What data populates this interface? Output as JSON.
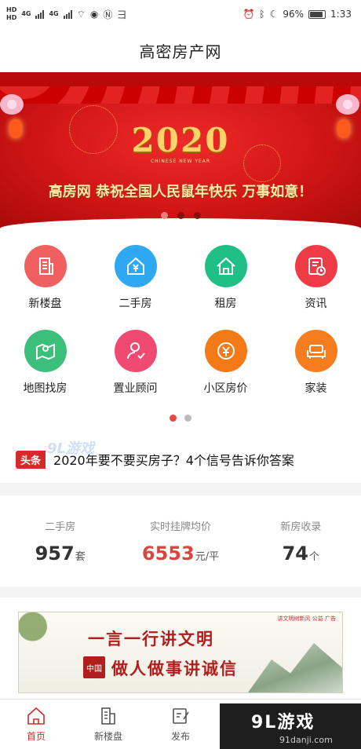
{
  "status_bar": {
    "hd1": "HD",
    "hd2": "HD",
    "net1": "4G",
    "net2": "4G",
    "battery": "96%",
    "time": "1:33"
  },
  "header": {
    "title": "高密房产网"
  },
  "banner": {
    "year": "2020",
    "year_sub": "CHINESE NEW YEAR",
    "slogan": "高房网 恭祝全国人民鼠年快乐 万事如意！",
    "slide_count": 3,
    "active_slide": 0
  },
  "menu": {
    "items": [
      {
        "label": "新楼盘",
        "icon": "building-icon",
        "color": "#f06060"
      },
      {
        "label": "二手房",
        "icon": "house-yuan-icon",
        "color": "#2ea8f0"
      },
      {
        "label": "租房",
        "icon": "home-icon",
        "color": "#1fbf86"
      },
      {
        "label": "资讯",
        "icon": "news-icon",
        "color": "#ee3b46"
      },
      {
        "label": "地图找房",
        "icon": "map-pin-icon",
        "color": "#3cbf7a"
      },
      {
        "label": "置业顾问",
        "icon": "advisor-icon",
        "color": "#f04a73"
      },
      {
        "label": "小区房价",
        "icon": "yuan-coin-icon",
        "color": "#f37a16"
      },
      {
        "label": "家装",
        "icon": "sofa-icon",
        "color": "#f57d1f"
      }
    ],
    "page_count": 2,
    "active_page": 0
  },
  "headline": {
    "tag": "头条",
    "watermark": "9L游戏",
    "text": "2020年要不要买房子？4个信号告诉你答案"
  },
  "stats": [
    {
      "title": "二手房",
      "value": "957",
      "unit": "套"
    },
    {
      "title": "实时挂牌均价",
      "value": "6553",
      "unit": "元/平"
    },
    {
      "title": "新房收录",
      "value": "74",
      "unit": "个"
    }
  ],
  "ad": {
    "line1": "一言一行讲文明",
    "line2": "做人做事讲诚信",
    "seal": "中国",
    "small": "讲文明树新风 公益 广告"
  },
  "tabbar": {
    "items": [
      {
        "label": "首页",
        "icon": "home-icon",
        "active": true
      },
      {
        "label": "新楼盘",
        "icon": "building-icon",
        "active": false
      },
      {
        "label": "发布",
        "icon": "edit-icon",
        "active": false
      }
    ]
  },
  "promo": {
    "name": "9L游戏",
    "url": "91danji.com"
  }
}
